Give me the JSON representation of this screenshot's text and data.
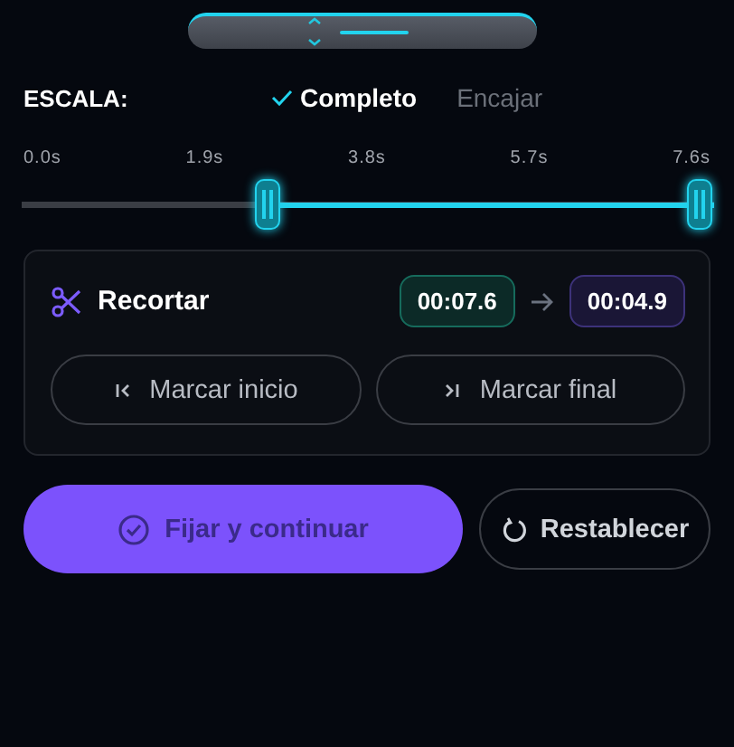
{
  "scale": {
    "label": "ESCALA:",
    "options": [
      {
        "label": "Completo",
        "selected": true
      },
      {
        "label": "Encajar",
        "selected": false
      }
    ]
  },
  "ticks": [
    "0.0s",
    "1.9s",
    "3.8s",
    "5.7s",
    "7.6s"
  ],
  "range": {
    "handles": [
      {
        "level": 0.35
      },
      {
        "level": 1
      }
    ]
  },
  "trim": {
    "title": "Recortar",
    "from": "00:07.6",
    "to": "00:04.9",
    "buttons": [
      {
        "kind": "start",
        "label": "Marcar inicio"
      },
      {
        "kind": "end",
        "label": "Marcar final"
      }
    ]
  },
  "actions": [
    {
      "kind": "primary",
      "label": "Fijar y continuar"
    },
    {
      "kind": "reset",
      "label": "Restablecer"
    }
  ]
}
